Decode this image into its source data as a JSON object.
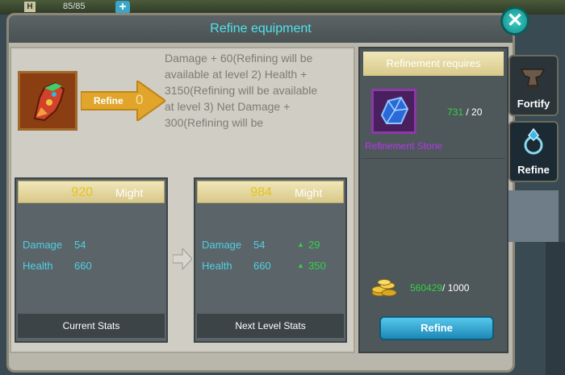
{
  "hud": {
    "hp_chip": "H",
    "hp_text": "85/85",
    "hp_plus": "+"
  },
  "window": {
    "title": "Refine equipment",
    "close_label": "✕"
  },
  "item": {
    "icon": "gauntlet-icon"
  },
  "refine": {
    "arrow_label": "Refine",
    "arrow_count": "0",
    "description": "Damage + 60(Refining will be available at level 2) Health + 3150(Refining will be available at level 3) Net Damage + 300(Refining will be"
  },
  "current_stats": {
    "might_value": "920",
    "might_label": "Might",
    "rows": [
      {
        "name": "Damage",
        "value": "54"
      },
      {
        "name": "Health",
        "value": "660"
      }
    ],
    "footer": "Current Stats"
  },
  "next_stats": {
    "might_value": "984",
    "might_label": "Might",
    "rows": [
      {
        "name": "Damage",
        "value": "54",
        "increase": "29"
      },
      {
        "name": "Health",
        "value": "660",
        "increase": "350"
      }
    ],
    "footer": "Next Level Stats"
  },
  "requirements": {
    "header": "Refinement requires",
    "stone_name": "Refinement Stone",
    "stone_have": "731",
    "stone_need": " / 20",
    "gold_have": "560429",
    "gold_need": "/ 1000",
    "button_label": "Refine"
  },
  "side_tabs": [
    {
      "label": "Fortify",
      "icon": "anvil-icon"
    },
    {
      "label": "Refine",
      "icon": "gem-ring-icon"
    }
  ],
  "colors": {
    "accent_cyan": "#4fe3ee",
    "stat_cyan": "#4fd0e6",
    "increase_green": "#33d04a",
    "might_gold": "#e7c21e",
    "stone_purple": "#b438f0"
  }
}
